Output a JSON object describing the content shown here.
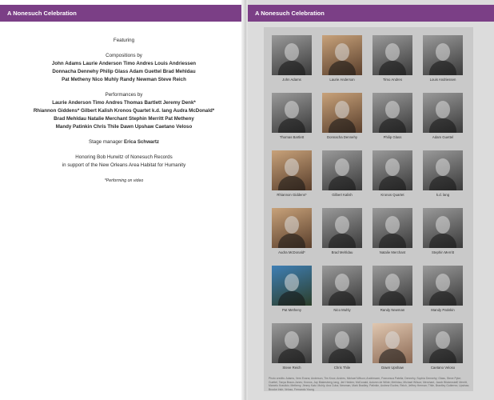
{
  "header": {
    "left_title": "A Nonesuch Celebration",
    "right_title": "A Nonesuch Celebration"
  },
  "program": {
    "featuring": "Featuring",
    "compositions_heading": "Compositions by",
    "compositions_lines": [
      "John Adams   Laurie Anderson   Timo Andres   Louis Andriessen",
      "Donnacha Dennehy   Philip Glass   Adam Guettel   Brad Mehldau",
      "Pat Metheny   Nico Muhly   Randy Newman   Steve Reich"
    ],
    "performances_heading": "Performances by",
    "performances_lines": [
      "Laurie Anderson   Timo Andres   Thomas Bartlett   Jeremy Denk*",
      "Rhiannon Giddens*   Gilbert Kalish   Kronos Quartet   k.d. lang   Audra McDonald*",
      "Brad Mehldau   Natalie Merchant   Stephin Merritt   Pat Metheny",
      "Mandy Patinkin   Chris Thile   Dawn Upshaw   Caetano Veloso"
    ],
    "stage_manager_label": "Stage manager",
    "stage_manager_name": "Erica Schwartz",
    "honoring_lines": [
      "Honoring Bob Hurwitz of Nonesuch Records",
      "in support of the New Orleans Area Habitat for Humanity"
    ],
    "footnote": "*Performing on video"
  },
  "gallery": [
    "John Adams",
    "Laurie Anderson",
    "Timo Andres",
    "Louis Andriessen",
    "Thomas Bartlett",
    "Donnacha Dennehy",
    "Philip Glass",
    "Adam Guettel",
    "Rhiannon Giddens*",
    "Gilbert Kalish",
    "Kronos Quartet",
    "k.d. lang",
    "Audra McDonald*",
    "Brad Mehldau",
    "Natalie Merchant",
    "Stephin Merritt",
    "Pat Metheny",
    "Nico Muhly",
    "Randy Newman",
    "Mandy Patinkin",
    "Steve Reich",
    "Chris Thile",
    "Dawn Upshaw",
    "Caetano Veloso"
  ],
  "photo_credits": "Photo credits: Adams, Vern Evans; Anderson, Tim Knox; Andres, Michael Wilson; Andriessen, Francesca Patella; Dennehy, Sophia Dennehy; Glass, Steve Pyke; Guettel, Tanya Braun-Jones; Kronos, Jay Blakesberg; lang, Jeri Heiden; McDonald, Autumn de Wilde; Mehldau, Michael Wilson; Merchant, Jacob Blickenstaff; Merritt, Marcelo Krasilcic; Metheny, Jimmy Katz; Muhly, Ana Cuba; Newman, Mark Bradley; Patinkin, Andrew Eccles; Reich, Jeffrey Herman; Thile, Brantley Gutierrez; Upshaw, Brooke Irish; Veloso, Fernando Young",
  "colors": {
    "accent": "#7b3f86",
    "panel": "#c9c9c9",
    "page_bg": "#dcdcdc"
  }
}
